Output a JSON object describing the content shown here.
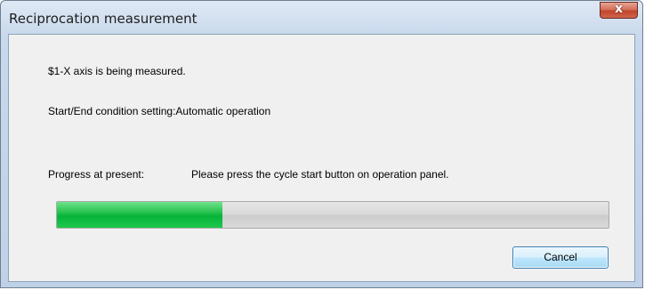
{
  "window": {
    "title": "Reciprocation measurement",
    "close_label": "x"
  },
  "messages": {
    "axis_status": "$1-X axis is being measured.",
    "condition": "Start/End condition setting:Automatic operation"
  },
  "progress": {
    "label": "Progress at present:",
    "instruction": "Please press the cycle start button on operation panel.",
    "fraction": 0.3
  },
  "buttons": {
    "cancel_label": "Cancel"
  },
  "colors": {
    "progress_fill": "#06b33a",
    "close_button": "#c1452c"
  }
}
